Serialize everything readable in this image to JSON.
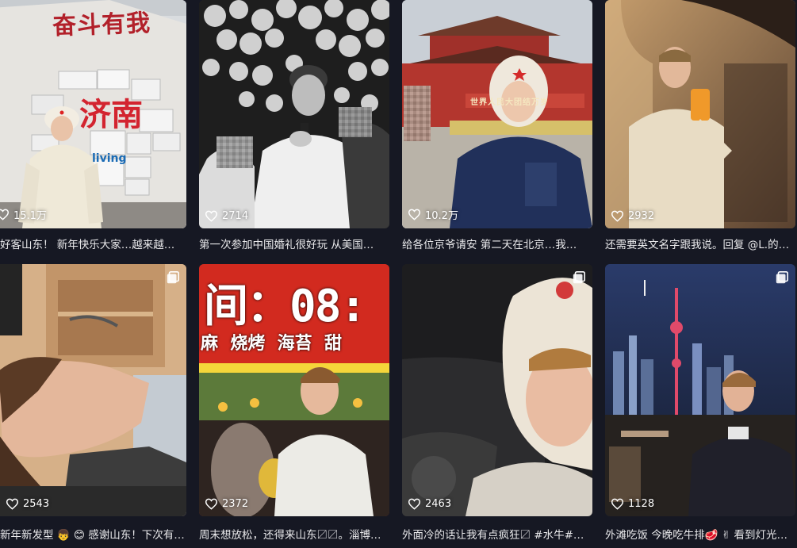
{
  "videos": [
    {
      "likes": "15.1万",
      "caption": "好客山东！ 新年快乐大家…越来越…",
      "sign": "奋斗有我",
      "sign2": "济南",
      "sign3": "living",
      "multi": false
    },
    {
      "likes": "2714",
      "caption": "第一次参加中国婚礼很好玩 从美国…",
      "multi": false
    },
    {
      "likes": "10.2万",
      "caption": "给各位京爷请安 第二天在北京…我…",
      "banner": "世界人民大团结万岁",
      "multi": false
    },
    {
      "likes": "2932",
      "caption": "还需要英文名字跟我说。回复 @L.的…",
      "multi": false
    },
    {
      "likes": "2543",
      "caption": "新年新发型 👦 😊 感谢山东！下次有…",
      "multi": true
    },
    {
      "likes": "2372",
      "caption": "周末想放松，还得来山东〼〼。淄博…",
      "sign": "间：08:",
      "sign2": "麻  烧烤  海苔  甜",
      "multi": false
    },
    {
      "likes": "2463",
      "caption": "外面冷的话让我有点疯狂〼 #水牛#…",
      "multi": true
    },
    {
      "likes": "1128",
      "caption": "外滩吃饭 今晚吃牛排🥩 ✌ 看到灯光…",
      "multi": true
    }
  ],
  "icons": {
    "like": "heart-outline-icon",
    "multi": "multi-image-icon"
  },
  "colors": {
    "background": "#161823",
    "text": "#e9e9eb"
  }
}
